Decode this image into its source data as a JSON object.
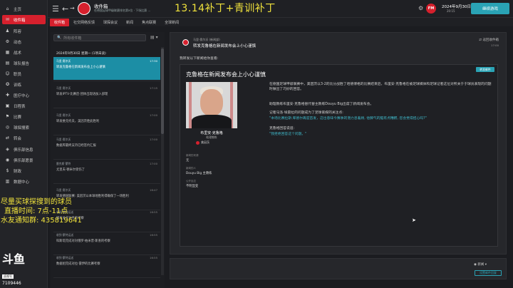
{
  "sidebar": {
    "items": [
      {
        "label": "主页",
        "icon": "home-icon",
        "glyph": "⌂"
      },
      {
        "label": "收件箱",
        "icon": "inbox-icon",
        "glyph": "✉",
        "active": true
      },
      {
        "label": "阵容",
        "icon": "squad-icon",
        "glyph": "♟"
      },
      {
        "label": "动态",
        "icon": "dynamics-icon",
        "glyph": "⚙"
      },
      {
        "label": "战术",
        "icon": "tactics-icon",
        "glyph": "▦"
      },
      {
        "label": "球队报告",
        "icon": "report-icon",
        "glyph": "▤"
      },
      {
        "label": "职员",
        "icon": "staff-icon",
        "glyph": "☺"
      },
      {
        "label": "训练",
        "icon": "training-icon",
        "glyph": "✪"
      },
      {
        "label": "医疗中心",
        "icon": "medical-icon",
        "glyph": "✚"
      },
      {
        "label": "日程表",
        "icon": "calendar-icon",
        "glyph": "▣"
      },
      {
        "label": "比赛",
        "icon": "match-icon",
        "glyph": "⚑"
      },
      {
        "label": "球探搜索",
        "icon": "scouting-icon",
        "glyph": "◎"
      },
      {
        "label": "转会",
        "icon": "transfer-icon",
        "glyph": "⇄"
      },
      {
        "label": "俱乐部信息",
        "icon": "club-info-icon",
        "glyph": "◈"
      },
      {
        "label": "俱乐部愿景",
        "icon": "vision-icon",
        "glyph": "◉"
      },
      {
        "label": "财政",
        "icon": "finance-icon",
        "glyph": "$"
      },
      {
        "label": "数据中心",
        "icon": "data-hub-icon",
        "glyph": "▥"
      }
    ]
  },
  "topbar": {
    "title": "收件箱",
    "subtitle": "在德国足球甲级联赛排名第x位 · 下场比赛 ...",
    "overlay": "13.14补丁+青训补丁",
    "fm": "FM",
    "date": "2024年9月30日 星期一",
    "time": "20:15",
    "continue": "继续游戏"
  },
  "tabs": [
    "收件箱",
    "社交网络反馈",
    "球探会议",
    "新闻",
    "焦点联赛",
    "全球新闻"
  ],
  "inbox": {
    "search_placeholder": "所有收件箱",
    "group": "2024年9月30日 星期一 (1项未读)",
    "messages": [
      {
        "sender": "马里·奥尔沃",
        "subject": "转发克鲁格在新闻发布会上小心谨慎",
        "time": "17:30",
        "selected": true
      },
      {
        "sender": "马里·奥尔沃",
        "subject": "转发IPTV·比赛后·团体出现语加入部理",
        "time": "17:15"
      },
      {
        "sender": "马里·奥尔沃",
        "subject": "转发维克托夫，美因茨胜此胜利",
        "time": "17:00"
      },
      {
        "sender": "马里·奥尔沃",
        "subject": "数据库最终支持已经签约汇报",
        "time": "17:00"
      },
      {
        "sender": "雷克斯·蒙特",
        "subject": "尤里夫·德米尔受伤了",
        "time": "17:00"
      },
      {
        "sender": "马里·奥尔沃",
        "subject": "转发德国联赛: 美因茨以本球地胜利得确保了一场胜利",
        "time": "16:47"
      },
      {
        "sender": "收到·蒙特运送",
        "subject": "转发关于对手的考察",
        "time": "16:55"
      },
      {
        "sender": "收到·蒙特运送",
        "subject": "科斯塔完成对对俄罗·柏米普·斯查的考察",
        "time": "16:55"
      },
      {
        "sender": "收到·蒙特运送",
        "subject": "数据组完成对拉·雷伊的比赛考察",
        "time": "16:55"
      }
    ]
  },
  "content": {
    "sender": "马里·奥尔沃 (新闻部)",
    "subject": "转发克鲁格在新闻发布会上小心谨慎",
    "action": "返回收件箱",
    "date": "17:00",
    "intro": "我转发以下新闻给你查看:",
    "news_badge": "转发邮件",
    "news_title": "克鲁格在新闻发布会上小心谨慎",
    "person_name": "布里安·克鲁格",
    "person_role": "助理教练",
    "person_club": "美因茨",
    "info": [
      {
        "label": "新闻的来源",
        "value": "无"
      },
      {
        "label": "新闻的人",
        "value": "Douyu Big 主教练"
      },
      {
        "label": "公开反应",
        "value": "不明显变"
      }
    ],
    "paragraphs": [
      "在德国足球甲级联赛中，美因茨以3-2的比分战胜了哈德博格的比赛结束后，布里安·克鲁格在被足球媒体和足球记者这位对所关于于球员表现的问题时做出了巧妙的回答。",
      "助理教练布里安·克鲁格替代替主教练Douyu Big出席了新闻发布会。",
      "记者马洛·埃雷拉的问题成为了足球家媒的关注点:",
      "\"本场比赛拉斯·库德尔再度首发，这也意味今赛季的潜力息着顾, 他脾气的脑有点糟糕, 您会觉得担心吗?\"",
      "克鲁格回答说道:",
      "\"我拒绝回答这个问题。\""
    ]
  },
  "reply": {
    "dropdown": "新闻",
    "button": "设置邮件回复"
  },
  "overlay": {
    "line1": "尽量买球探搜到的球员",
    "line2": "直播时间: 7点-11点",
    "line3": "水友通知群: 435819641",
    "douyu_logo": "斗鱼",
    "douyu_tag": "虎视号",
    "douyu_id": "7109446"
  },
  "colors": {
    "accent": "#d6202d",
    "teal": "#2aa3b5",
    "overlay_yellow": "#f1e33c"
  }
}
